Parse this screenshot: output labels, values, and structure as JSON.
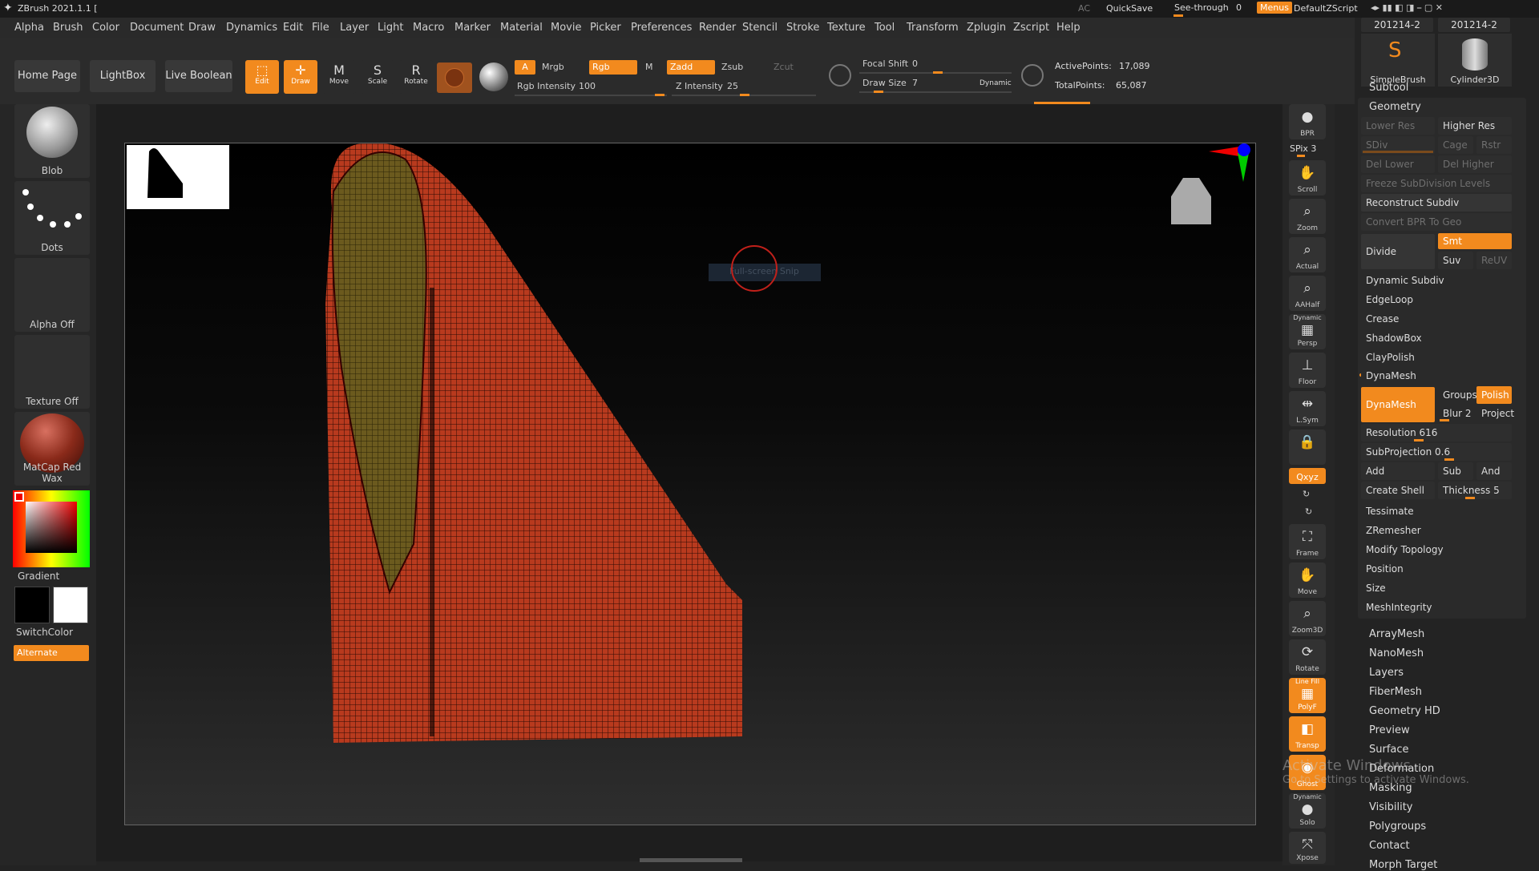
{
  "window": {
    "title": "ZBrush 2021.1.1 [",
    "ac": "AC",
    "quicksave": "QuickSave",
    "seethrough": "See-through",
    "seethrough_value": "0",
    "menus": "Menus",
    "script": "DefaultZScript"
  },
  "menus": [
    "Alpha",
    "Brush",
    "Color",
    "Document",
    "Draw",
    "Dynamics",
    "Edit",
    "File",
    "Layer",
    "Light",
    "Macro",
    "Marker",
    "Material",
    "Movie",
    "Picker",
    "Preferences",
    "Render",
    "Stencil",
    "Stroke",
    "Texture",
    "Tool",
    "Transform",
    "Zplugin",
    "Zscript",
    "Help"
  ],
  "toolbar": {
    "home": "Home Page",
    "lightbox": "LightBox",
    "liveboolean": "Live Boolean",
    "edit": "Edit",
    "draw": "Draw",
    "move": "Move",
    "scale": "Scale",
    "rotate": "Rotate",
    "a": "A",
    "mrgb": "Mrgb",
    "rgb": "Rgb",
    "m": "M",
    "zadd": "Zadd",
    "zsub": "Zsub",
    "zcut": "Zcut",
    "rgb_intensity_label": "Rgb Intensity",
    "rgb_intensity": "100",
    "z_intensity_label": "Z Intensity",
    "z_intensity": "25",
    "focal_label": "Focal Shift",
    "focal": "0",
    "drawsize_label": "Draw Size",
    "drawsize": "7",
    "dynamic": "Dynamic",
    "active_label": "ActivePoints:",
    "active": "17,089",
    "total_label": "TotalPoints:",
    "total": "65,087"
  },
  "left": {
    "blob": "Blob",
    "dots": "Dots",
    "alpha": "Alpha Off",
    "texture": "Texture Off",
    "matcap": "MatCap Red Wax",
    "gradient": "Gradient",
    "switchcolor": "SwitchColor",
    "alternate": "Alternate"
  },
  "viewport": {
    "overlay_text": "Full-screen Snip"
  },
  "right": [
    {
      "id": "bpr",
      "label": "BPR"
    },
    {
      "id": "spix",
      "label": "SPix 3"
    },
    {
      "id": "scroll",
      "label": "Scroll"
    },
    {
      "id": "zoom",
      "label": "Zoom"
    },
    {
      "id": "actual",
      "label": "Actual"
    },
    {
      "id": "aahalf",
      "label": "AAHalf"
    },
    {
      "id": "persp",
      "label": "Persp"
    },
    {
      "id": "floor",
      "label": "Floor"
    },
    {
      "id": "lsym",
      "label": "L.Sym"
    },
    {
      "id": "xyz",
      "label": "Qxyz"
    },
    {
      "id": "frame",
      "label": "Frame"
    },
    {
      "id": "move",
      "label": "Move"
    },
    {
      "id": "zoom3d",
      "label": "Zoom3D"
    },
    {
      "id": "rotate",
      "label": "Rotate"
    },
    {
      "id": "polyf",
      "label": "PolyF"
    },
    {
      "id": "transp",
      "label": "Transp"
    },
    {
      "id": "ghost",
      "label": "Ghost"
    },
    {
      "id": "solo",
      "label": "Solo"
    },
    {
      "id": "xpose",
      "label": "Xpose"
    }
  ],
  "right_extra": {
    "dynamic": "Dynamic",
    "linefill": "Line Fill"
  },
  "panel": {
    "tab1": "201214-2",
    "tab2": "201214-2",
    "brush1": "SimpleBrush",
    "brush2": "Cylinder3D",
    "subtool": "Subtool",
    "geometry": "Geometry",
    "lowerres": "Lower Res",
    "higherres": "Higher Res",
    "sdiv": "SDiv",
    "cage": "Cage",
    "rstr": "Rstr",
    "dellower": "Del Lower",
    "delhigher": "Del Higher",
    "freeze": "Freeze SubDivision Levels",
    "reconstruct": "Reconstruct Subdiv",
    "convert": "Convert BPR To Geo",
    "divide": "Divide",
    "smt": "Smt",
    "suv": "Suv",
    "reuv": "ReUV",
    "dynsubdiv": "Dynamic Subdiv",
    "edgeloop": "EdgeLoop",
    "crease": "Crease",
    "shadowbox": "ShadowBox",
    "claypolish": "ClayPolish",
    "dynamesh_header": "DynaMesh",
    "dynamesh_btn": "DynaMesh",
    "groups": "Groups",
    "polish": "Polish",
    "blur": "Blur 2",
    "project": "Project",
    "resolution": "Resolution 616",
    "subprojection": "SubProjection 0.6",
    "add": "Add",
    "sub": "Sub",
    "and": "And",
    "createshell": "Create Shell",
    "thickness": "Thickness 5",
    "tessimate": "Tessimate",
    "zremesher": "ZRemesher",
    "modifytopo": "Modify Topology",
    "position": "Position",
    "size": "Size",
    "meshintegrity": "MeshIntegrity",
    "arraymesh": "ArrayMesh",
    "nanomesh": "NanoMesh",
    "layers": "Layers",
    "fibermesh": "FiberMesh",
    "geometryhd": "Geometry HD",
    "preview": "Preview",
    "surface": "Surface",
    "deformation": "Deformation",
    "masking": "Masking",
    "visibility": "Visibility",
    "polygroups": "Polygroups",
    "contact": "Contact",
    "morphtarget": "Morph Target"
  },
  "watermark": {
    "line1": "Activate Windows",
    "line2": "Go to Settings to activate Windows."
  },
  "colors": {
    "accent": "#f28a1e",
    "mesh": "#b83a1e",
    "inner": "#6b5a1e"
  }
}
